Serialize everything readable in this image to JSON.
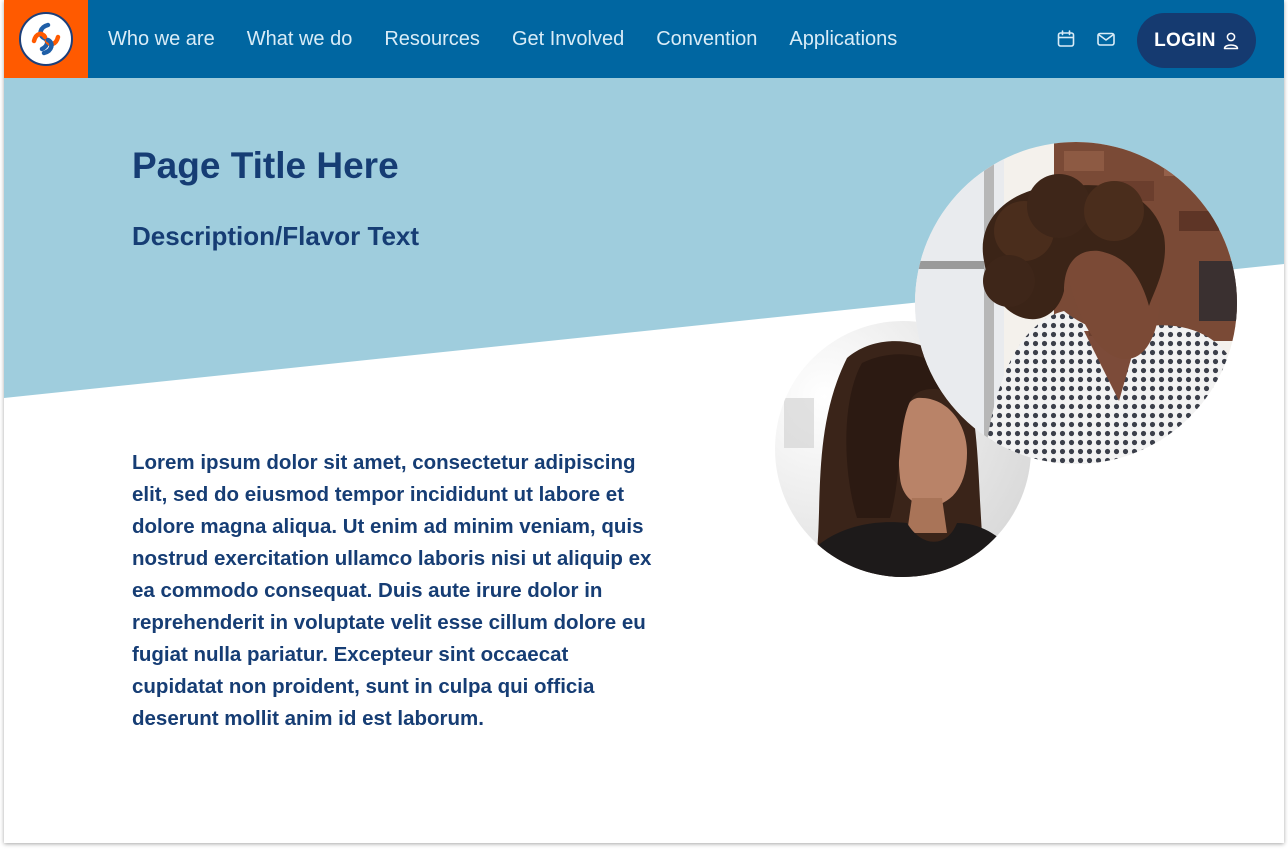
{
  "nav": {
    "items": [
      {
        "label": "Who we are"
      },
      {
        "label": "What we do"
      },
      {
        "label": "Resources"
      },
      {
        "label": "Get Involved"
      },
      {
        "label": "Convention"
      },
      {
        "label": "Applications"
      }
    ]
  },
  "header": {
    "login_label": "LOGIN",
    "icons": [
      "calendar-icon",
      "mail-icon",
      "user-icon"
    ]
  },
  "hero": {
    "title": "Page Title Here",
    "description": "Description/Flavor Text"
  },
  "content": {
    "body": "Lorem ipsum dolor sit amet, consectetur adipiscing elit, sed do eiusmod tempor incididunt ut labore et dolore magna aliqua. Ut enim ad minim veniam, quis nostrud exercitation ullamco laboris nisi ut aliquip ex ea commodo consequat. Duis aute irure dolor in reprehenderit in voluptate velit esse cillum dolore eu fugiat nulla pariatur. Excepteur sint occaecat cupidatat non proident, sunt in culpa qui officia deserunt mollit anim id est laborum."
  },
  "colors": {
    "header_bg": "#0066a1",
    "logo_bg": "#ff5a00",
    "hero_band": "#9fcddd",
    "brand_navy": "#163d74",
    "login_bg": "#153a70"
  }
}
